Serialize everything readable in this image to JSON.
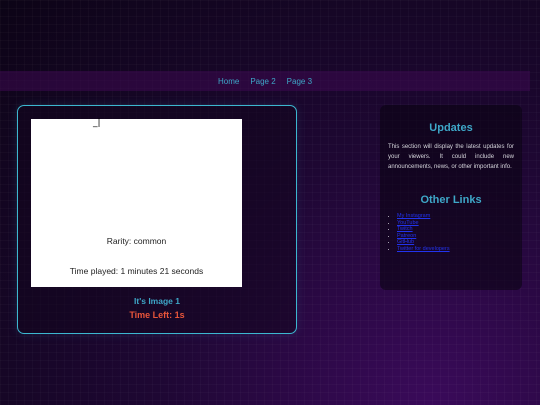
{
  "nav": {
    "items": [
      {
        "label": "Home"
      },
      {
        "label": "Page 2"
      },
      {
        "label": "Page 3"
      }
    ]
  },
  "card": {
    "screenshot": {
      "mark": "_|",
      "rarity": "Rarity: common",
      "time_played": "Time played: 1 minutes 21 seconds"
    },
    "title": "It's Image 1",
    "time_left": "Time Left: 1s"
  },
  "sidebar": {
    "updates_title": "Updates",
    "updates_text": "This section will display the latest updates for your viewers. It could include new announcements, news, or other important info.",
    "links_title": "Other Links",
    "links": [
      {
        "label": "My Instagram"
      },
      {
        "label": "YouTube"
      },
      {
        "label": "Twitch"
      },
      {
        "label": "Patreon"
      },
      {
        "label": "GitHub"
      },
      {
        "label": "Twitter for developers"
      }
    ]
  },
  "colors": {
    "accent": "#3ea7c8",
    "warning": "#e8553a",
    "link": "#2233ee"
  }
}
